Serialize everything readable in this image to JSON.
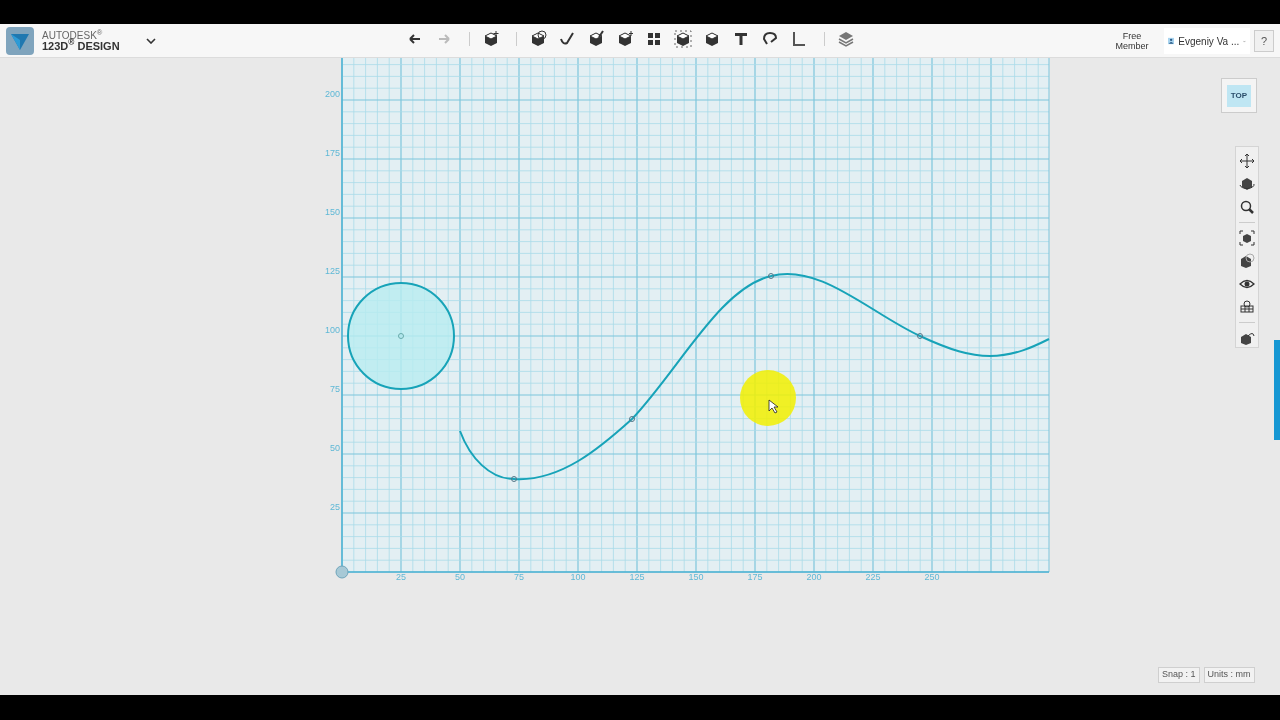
{
  "app": {
    "brand": "AUTODESK$^{®}$",
    "product": "123D$^{®}$ DESIGN"
  },
  "account": {
    "membership": "Free Member",
    "user": "Evgeniy Va ...",
    "help": "?"
  },
  "view_cube": {
    "label": "TOP"
  },
  "grid": {
    "x_labels": [
      "25",
      "50",
      "75",
      "100",
      "125",
      "150",
      "175",
      "200",
      "225",
      "250"
    ],
    "y_labels": [
      "200",
      "175",
      "150",
      "125",
      "100",
      "75",
      "50",
      "25"
    ]
  },
  "status_bar": {
    "snap": "Snap : 1",
    "units": "Units : mm"
  }
}
